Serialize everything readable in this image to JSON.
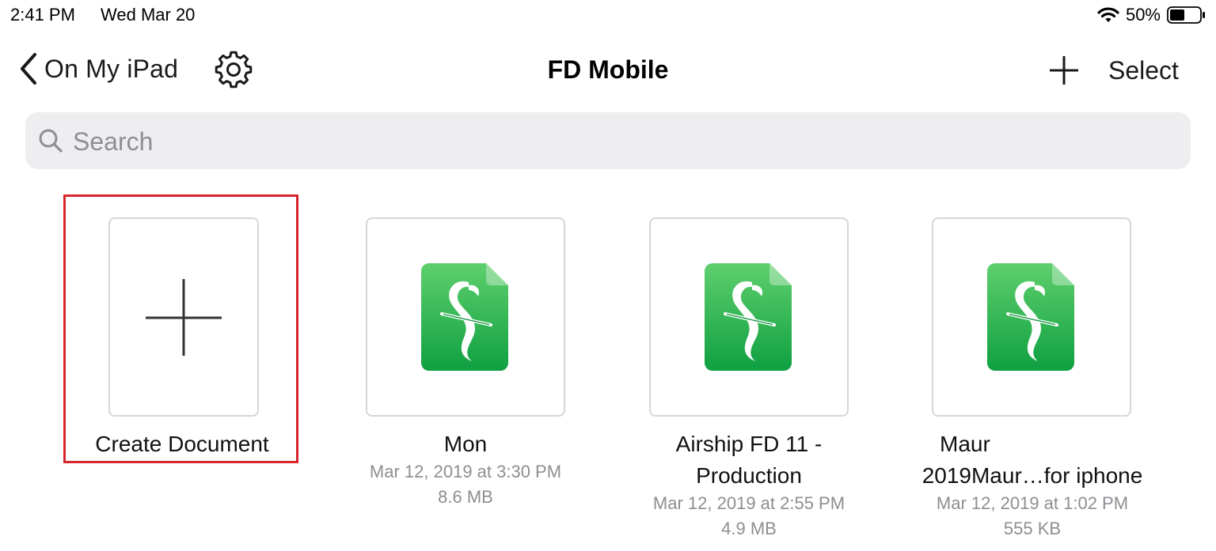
{
  "status_bar": {
    "time": "2:41 PM",
    "date": "Wed Mar 20",
    "battery_percent": "50%",
    "battery_level": 0.5,
    "wifi_icon": "wifi-icon",
    "battery_icon": "battery-icon"
  },
  "nav": {
    "back_label": "On My iPad",
    "title": "FD Mobile",
    "select_label": "Select",
    "settings_icon": "gear-icon",
    "add_icon": "plus-icon"
  },
  "search": {
    "placeholder": "Search",
    "value": ""
  },
  "items": [
    {
      "name": "Create Document",
      "type": "create"
    },
    {
      "name": "Mon",
      "date": "Mar 12, 2019 at 3:30 PM",
      "size": "8.6 MB",
      "type": "document"
    },
    {
      "name_line1": "Airship FD 11 -",
      "name_line2": "Production",
      "date": "Mar 12, 2019 at 2:55 PM",
      "size": "4.9 MB",
      "type": "document"
    },
    {
      "name_line1": "Maur",
      "name_line2": "2019Maur…for iphone",
      "date": "Mar 12, 2019 at 1:02 PM",
      "size": "555 KB",
      "type": "document"
    }
  ],
  "colors": {
    "highlight": "#d9262b",
    "doc_icon_green_top": "#5fcf6d",
    "doc_icon_green_bottom": "#0fa041",
    "secondary_text": "#8e8e93"
  }
}
